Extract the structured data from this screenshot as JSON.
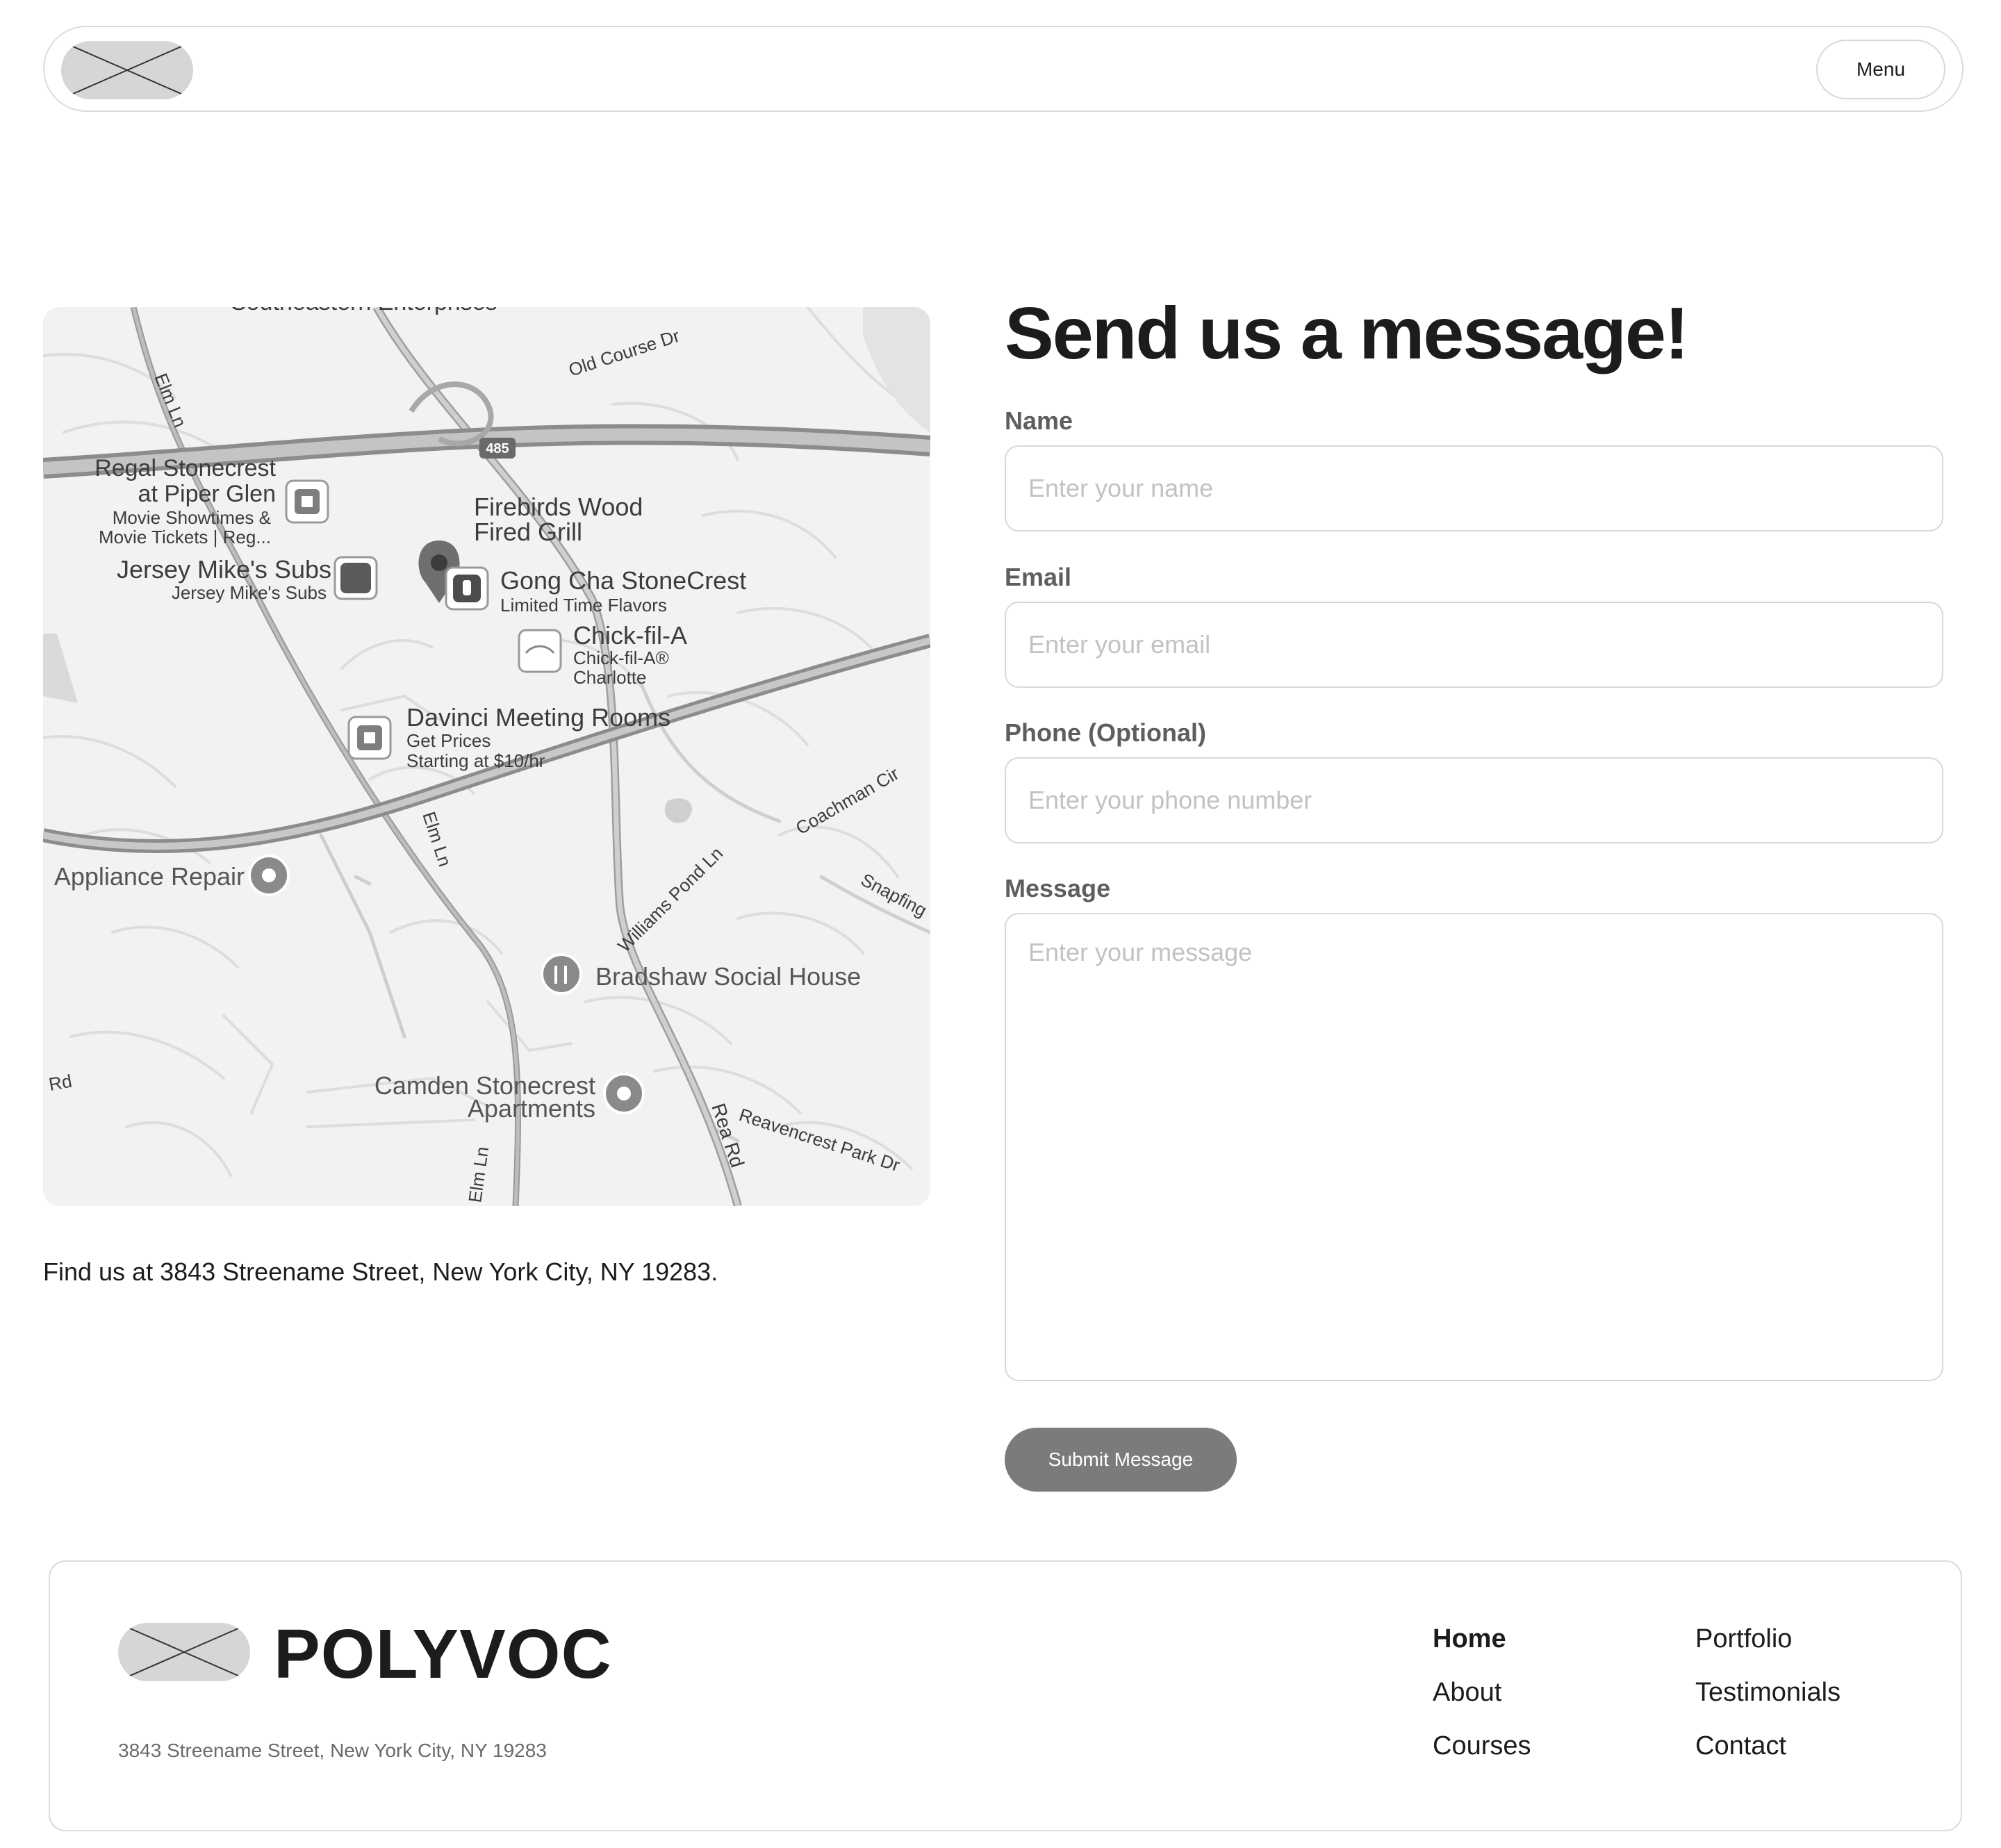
{
  "header": {
    "menu_label": "Menu"
  },
  "map": {
    "labels": {
      "southeastern": "Southeastern Enterprises",
      "old_course": "Old Course Dr",
      "elm_ln": "Elm Ln",
      "hwy": "485",
      "regal_1": "Regal Stonecrest",
      "regal_2": "at Piper Glen",
      "regal_sub1": "Movie Showtimes &",
      "regal_sub2": "Movie Tickets | Reg...",
      "firebirds_1": "Firebirds Wood",
      "firebirds_2": "Fired Grill",
      "jersey": "Jersey Mike's Subs",
      "jersey_sub": "Jersey Mike's Subs",
      "gongcha": "Gong Cha StoneCrest",
      "gongcha_sub": "Limited Time Flavors",
      "chick": "Chick-fil-A",
      "chick_sub1": "Chick-fil-A®",
      "chick_sub2": "Charlotte",
      "davinci": "Davinci Meeting Rooms",
      "davinci_sub1": "Get Prices",
      "davinci_sub2": "Starting at $10/hr",
      "appliance": "Appliance Repair",
      "williams": "Williams Pond Ln",
      "coachman": "Coachman Cir",
      "snapfinger": "Snapfing",
      "bradshaw": "Bradshaw Social House",
      "camden_1": "Camden Stonecrest",
      "camden_2": "Apartments",
      "rea": "Rea Rd",
      "reavencrest": "Reavencrest Park Dr",
      "rd_left": "Rd"
    }
  },
  "location": {
    "text": "Find us at 3843 Streename Street, New York City, NY 19283."
  },
  "form": {
    "title": "Send us a message!",
    "name_label": "Name",
    "name_placeholder": "Enter your name",
    "email_label": "Email",
    "email_placeholder": "Enter your email",
    "phone_label": "Phone (Optional)",
    "phone_placeholder": "Enter your phone number",
    "message_label": "Message",
    "message_placeholder": "Enter your message",
    "submit_label": "Submit Message"
  },
  "footer": {
    "brand": "POLYVOC",
    "address": "3843 Streename Street, New York City, NY 19283",
    "links_col1": [
      "Home",
      "About",
      "Courses"
    ],
    "links_col2": [
      "Portfolio",
      "Testimonials",
      "Contact"
    ]
  }
}
